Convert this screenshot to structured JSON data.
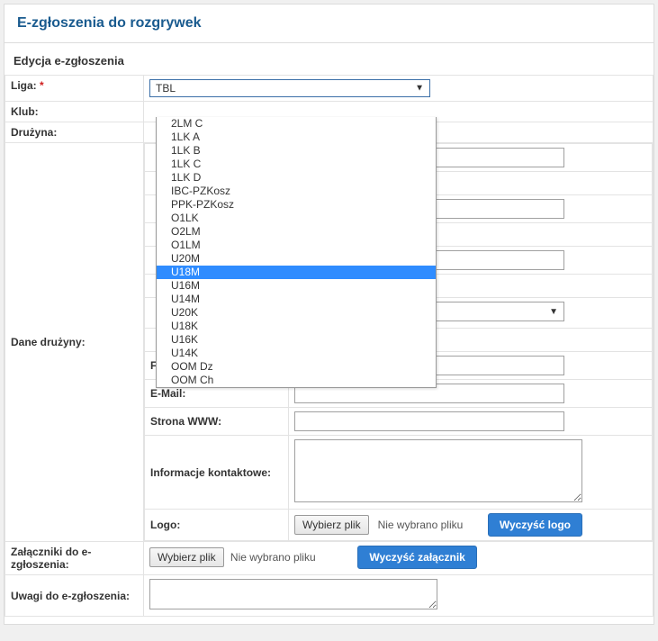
{
  "header": {
    "title": "E-zgłoszenia do rozgrywek",
    "subtitle": "Edycja e-zgłoszenia"
  },
  "labels": {
    "liga": "Liga:",
    "klub": "Klub:",
    "druzyna": "Drużyna:",
    "dane_druzyny": "Dane drużyny:",
    "fax": "Fax:",
    "email": "E-Mail:",
    "strona_www": "Strona WWW:",
    "info_kontakt": "Informacje kontaktowe:",
    "logo": "Logo:",
    "zalaczniki": "Załączniki do e-zgłoszenia:",
    "uwagi": "Uwagi do e-zgłoszenia:"
  },
  "liga_select": {
    "displayed": "TBL",
    "highlighted": "U18M",
    "options": [
      "2LM C",
      "1LK A",
      "1LK B",
      "1LK C",
      "1LK D",
      "IBC-PZKosz",
      "PPK-PZKosz",
      "O1LK",
      "O2LM",
      "O1LM",
      "U20M",
      "U18M",
      "U16M",
      "U14M",
      "U20K",
      "U18K",
      "U16K",
      "U14K",
      "OOM Dz",
      "OOM Ch"
    ]
  },
  "file_picker": {
    "button": "Wybierz plik",
    "no_file": "Nie wybrano pliku"
  },
  "buttons": {
    "clear_logo": "Wyczyść logo",
    "clear_attachment": "Wyczyść załącznik"
  },
  "required_marker": "*"
}
